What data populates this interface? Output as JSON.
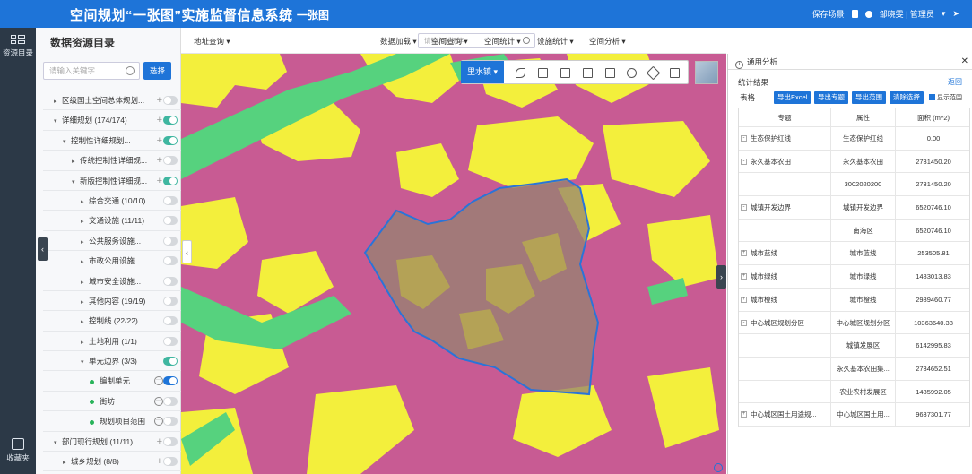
{
  "header": {
    "title": "空间规划“一张图”实施监督信息系统",
    "subtitle": "一张图",
    "save_scene": "保存场景",
    "user": "邹晓雯 | 管理员"
  },
  "rail": {
    "items": [
      {
        "label": "资源目录"
      },
      {
        "label": "收藏夹"
      }
    ]
  },
  "sidebar": {
    "title": "数据资源目录",
    "search_placeholder": "请输入关键字",
    "search_button": "选择",
    "items": [
      {
        "label": "区级国土空间总体规划...",
        "caret": "▸",
        "indent": 0,
        "plus": true,
        "toggle": "off"
      },
      {
        "label": "详细规划 (174/174)",
        "caret": "▾",
        "indent": 0,
        "plus": true,
        "toggle": "teal"
      },
      {
        "label": "控制性详细规划...",
        "caret": "▾",
        "indent": 1,
        "plus": true,
        "toggle": "teal"
      },
      {
        "label": "传统控制性详细规...",
        "caret": "▸",
        "indent": 2,
        "plus": true,
        "toggle": "off"
      },
      {
        "label": "新版控制性详细规...",
        "caret": "▾",
        "indent": 2,
        "plus": true,
        "toggle": "teal"
      },
      {
        "label": "综合交通 (10/10)",
        "caret": "▸",
        "indent": 3,
        "plus": false,
        "toggle": "off"
      },
      {
        "label": "交通设施 (11/11)",
        "caret": "▸",
        "indent": 3,
        "plus": false,
        "toggle": "off"
      },
      {
        "label": "公共服务设施...",
        "caret": "▸",
        "indent": 3,
        "plus": false,
        "toggle": "off"
      },
      {
        "label": "市政公用设施...",
        "caret": "▸",
        "indent": 3,
        "plus": false,
        "toggle": "off"
      },
      {
        "label": "城市安全设施...",
        "caret": "▸",
        "indent": 3,
        "plus": false,
        "toggle": "off"
      },
      {
        "label": "其他内容 (19/19)",
        "caret": "▸",
        "indent": 3,
        "plus": false,
        "toggle": "off"
      },
      {
        "label": "控制线 (22/22)",
        "caret": "▸",
        "indent": 3,
        "plus": false,
        "toggle": "off"
      },
      {
        "label": "土地利用 (1/1)",
        "caret": "▸",
        "indent": 3,
        "plus": false,
        "toggle": "off"
      },
      {
        "label": "单元边界 (3/3)",
        "caret": "▾",
        "indent": 3,
        "plus": false,
        "toggle": "teal"
      },
      {
        "label": "编制单元",
        "caret": "dot",
        "indent": 4,
        "plus": false,
        "opt": true,
        "toggle": "on"
      },
      {
        "label": "街坊",
        "caret": "dot",
        "indent": 4,
        "plus": false,
        "opt": true,
        "toggle": "off"
      },
      {
        "label": "规划项目范围",
        "caret": "dot",
        "indent": 4,
        "plus": false,
        "opt": true,
        "toggle": "off"
      },
      {
        "label": "部门现行规划 (11/11)",
        "caret": "▾",
        "indent": 0,
        "plus": true,
        "toggle": "off"
      },
      {
        "label": "城乡规划 (8/8)",
        "caret": "▸",
        "indent": 1,
        "plus": true,
        "toggle": "off"
      }
    ]
  },
  "toolbar": {
    "address": "地址查询",
    "search_placeholder": "请输入关键字",
    "menus": [
      "数据加载",
      "空间查询",
      "空间统计",
      "设施统计",
      "空间分析"
    ]
  },
  "map": {
    "district_button": "里水镇"
  },
  "panel": {
    "title": "通用分析",
    "section": "统计结果",
    "back": "返回",
    "table_label": "表格",
    "buttons": [
      "导出Excel",
      "导出专题",
      "导出范围",
      "清除选择"
    ],
    "show_range": "显示范围",
    "columns": [
      "专题",
      "属性",
      "面积 (m^2)"
    ],
    "rows": [
      {
        "topic": "生态保护红线",
        "pm": "-",
        "attr": "生态保护红线",
        "area": "0.00"
      },
      {
        "topic": "永久基本农田",
        "pm": "-",
        "attr": "永久基本农田",
        "area": "2731450.20"
      },
      {
        "topic": "",
        "pm": "",
        "attr": "3002020200",
        "area": "2731450.20"
      },
      {
        "topic": "城镇开发边界",
        "pm": "-",
        "attr": "城镇开发边界",
        "area": "6520746.10"
      },
      {
        "topic": "",
        "pm": "",
        "attr": "南海区",
        "area": "6520746.10"
      },
      {
        "topic": "城市蓝线",
        "pm": "+",
        "attr": "城市蓝线",
        "area": "253505.81"
      },
      {
        "topic": "城市绿线",
        "pm": "+",
        "attr": "城市绿线",
        "area": "1483013.83"
      },
      {
        "topic": "城市橙线",
        "pm": "+",
        "attr": "城市橙线",
        "area": "2989460.77"
      },
      {
        "topic": "中心城区规划分区",
        "pm": "-",
        "attr": "中心城区规划分区",
        "area": "10363640.38"
      },
      {
        "topic": "",
        "pm": "",
        "attr": "城镇发展区",
        "area": "6142995.83"
      },
      {
        "topic": "",
        "pm": "",
        "attr": "永久基本农田集...",
        "area": "2734652.51"
      },
      {
        "topic": "",
        "pm": "",
        "attr": "农业农村发展区",
        "area": "1485992.05"
      },
      {
        "topic": "中心城区国土用途规...",
        "pm": "+",
        "attr": "中心城区国土用...",
        "area": "9637301.77"
      }
    ]
  }
}
